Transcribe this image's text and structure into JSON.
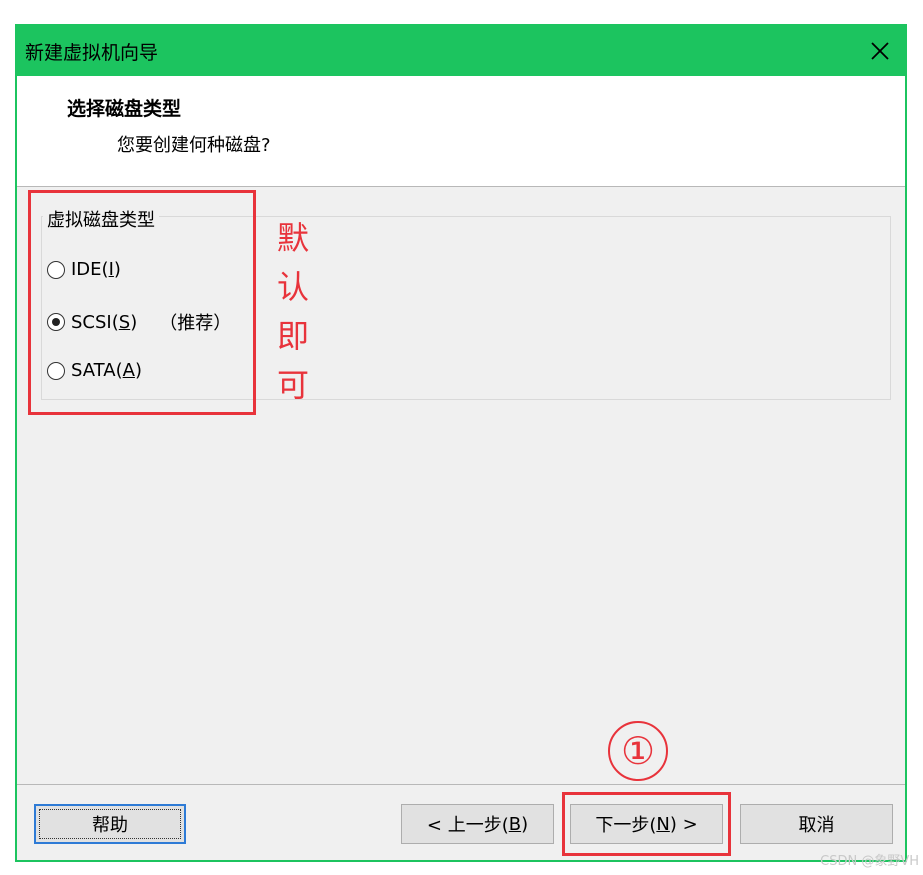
{
  "window": {
    "title": "新建虚拟机向导",
    "close_glyph": "✕",
    "accent_color": "#1cc45f"
  },
  "header": {
    "title": "选择磁盘类型",
    "subtitle": "您要创建何种磁盘?"
  },
  "disk_type_group": {
    "legend": "虚拟磁盘类型",
    "options": [
      {
        "label": "IDE(",
        "mnemonic": "I",
        "suffix": ")",
        "selected": false
      },
      {
        "label": "SCSI(",
        "mnemonic": "S",
        "suffix": ")",
        "selected": true,
        "note": "（推荐）"
      },
      {
        "label": "SATA(",
        "mnemonic": "A",
        "suffix": ")",
        "selected": false
      }
    ]
  },
  "annotations": {
    "vertical_text": [
      "默",
      "认",
      "即",
      "可"
    ],
    "step_marker": "①",
    "color": "#e8333b"
  },
  "buttons": {
    "help": "帮助",
    "back_prefix": "< 上一步(",
    "back_mnemonic": "B",
    "back_suffix": ")",
    "next_prefix": "下一步(",
    "next_mnemonic": "N",
    "next_suffix": ") >",
    "cancel": "取消"
  },
  "watermark": "CSDN @象野VH"
}
